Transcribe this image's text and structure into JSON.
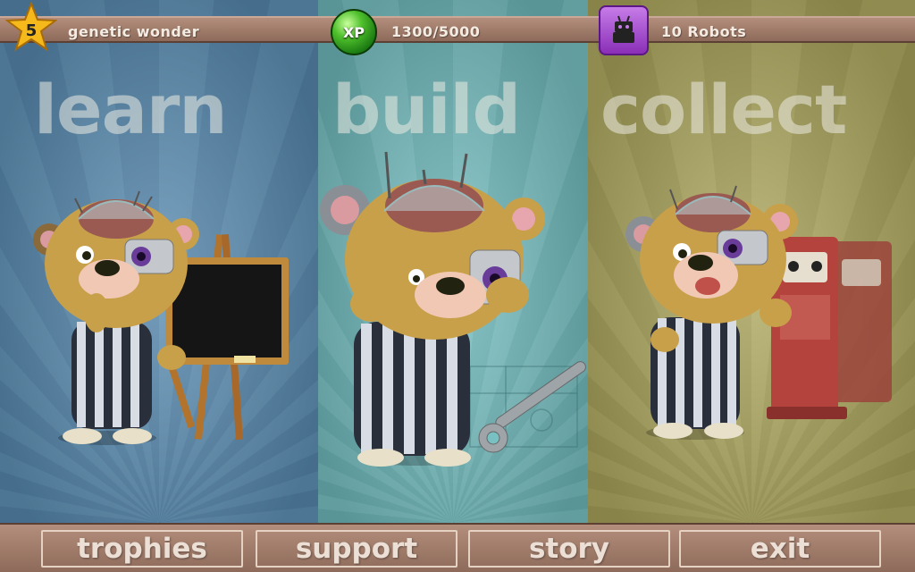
{
  "status_bar": {
    "level": {
      "value": "5",
      "title": "genetic wonder",
      "icon": "star-icon"
    },
    "xp": {
      "badge_label": "XP",
      "progress": "1300/5000",
      "icon": "xp-orb-icon"
    },
    "robots": {
      "count_label": "10 Robots",
      "icon": "robot-icon"
    }
  },
  "panels": [
    {
      "title": "learn",
      "color": "#5e90b4"
    },
    {
      "title": "build",
      "color": "#79c0c2"
    },
    {
      "title": "collect",
      "color": "#b0aa62"
    }
  ],
  "menu": {
    "trophies": "trophies",
    "support": "support",
    "story": "story",
    "exit": "exit"
  }
}
